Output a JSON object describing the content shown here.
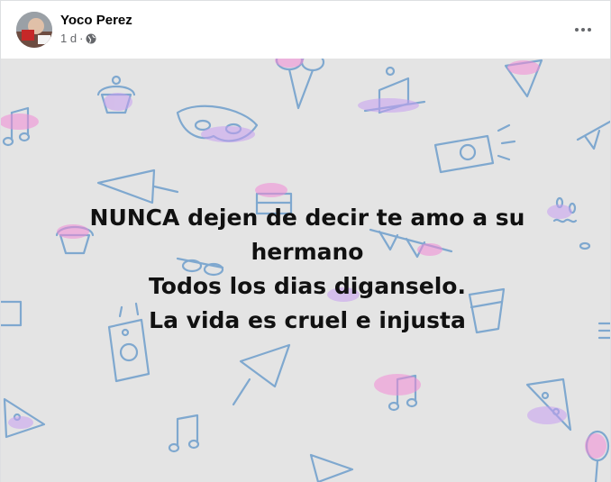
{
  "post": {
    "author": "Yoco Perez",
    "time": "1 d",
    "separator": "·",
    "privacy_icon": "globe-icon",
    "more_icon": "more-horizontal-icon",
    "text_lines": [
      "NUNCA dejen de decir te amo a su",
      "hermano",
      "Todos los dias diganselo.",
      "La vida es cruel e injusta"
    ]
  },
  "colors": {
    "background": "#e4e4e4",
    "doodle_blue": "#7fa8cf",
    "doodle_pink": "#f28bd6",
    "doodle_purple": "#c79ef0",
    "text": "#111111",
    "secondary_text": "#65676b"
  }
}
